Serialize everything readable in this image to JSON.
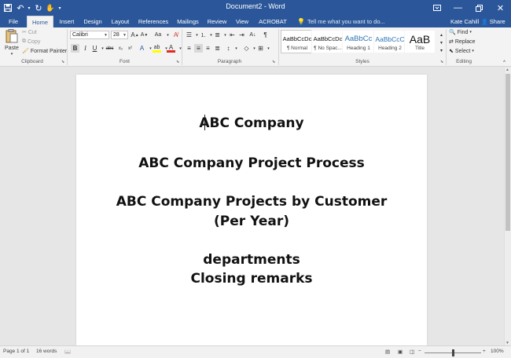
{
  "app": {
    "title": "Document2 - Word"
  },
  "tabs": [
    {
      "label": "File",
      "active": false
    },
    {
      "label": "Home",
      "active": true
    },
    {
      "label": "Insert",
      "active": false
    },
    {
      "label": "Design",
      "active": false
    },
    {
      "label": "Layout",
      "active": false
    },
    {
      "label": "References",
      "active": false
    },
    {
      "label": "Mailings",
      "active": false
    },
    {
      "label": "Review",
      "active": false
    },
    {
      "label": "View",
      "active": false
    },
    {
      "label": "ACROBAT",
      "active": false
    }
  ],
  "tell_me": {
    "placeholder": "Tell me what you want to do..."
  },
  "user": {
    "name": "Kate Cahill",
    "share_label": "Share"
  },
  "clipboard": {
    "paste": "Paste",
    "cut": "Cut",
    "copy": "Copy",
    "format_painter": "Format Painter",
    "label": "Clipboard"
  },
  "font": {
    "name": "Calibri",
    "size": "28",
    "label": "Font",
    "font_color": "#e02b20",
    "highlight_color": "#ffff00"
  },
  "paragraph": {
    "label": "Paragraph"
  },
  "styles": {
    "label": "Styles",
    "items": [
      {
        "preview": "AaBbCcDc",
        "name": "¶ Normal"
      },
      {
        "preview": "AaBbCcDc",
        "name": "¶ No Spac..."
      },
      {
        "preview": "AaBbCc",
        "name": "Heading 1"
      },
      {
        "preview": "AaBbCcC",
        "name": "Heading 2"
      },
      {
        "preview": "AaB",
        "name": "Title"
      }
    ]
  },
  "editing": {
    "find": "Find",
    "replace": "Replace",
    "select": "Select",
    "label": "Editing"
  },
  "document": {
    "lines": [
      "ABC Company",
      "ABC Company Project Process",
      "ABC Company Projects by Customer",
      "(Per Year)",
      "departments",
      "Closing remarks"
    ]
  },
  "status": {
    "page": "Page 1 of 1",
    "words": "16 words",
    "zoom": "100%",
    "zoom_fraction": 0.5
  },
  "colors": {
    "brand": "#2b579a",
    "ribbon_bg": "#f3f3f3",
    "canvas_bg": "#e6e6e6"
  }
}
